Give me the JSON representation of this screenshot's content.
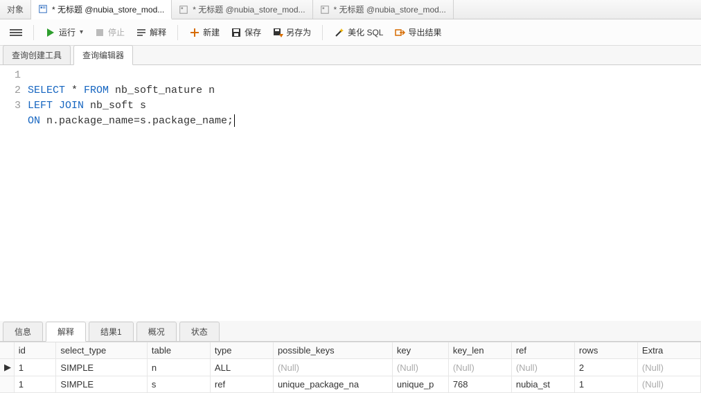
{
  "top_tabs": [
    {
      "label": "对象",
      "active": false,
      "icon": "object"
    },
    {
      "label": "* 无标题 @nubia_store_mod...",
      "active": true,
      "icon": "query"
    },
    {
      "label": "* 无标题 @nubia_store_mod...",
      "active": false,
      "icon": "query"
    },
    {
      "label": "* 无标题 @nubia_store_mod...",
      "active": false,
      "icon": "query"
    }
  ],
  "toolbar": {
    "run": "运行",
    "stop": "停止",
    "explain": "解释",
    "new": "新建",
    "save": "保存",
    "saveas": "另存为",
    "beautify": "美化 SQL",
    "export": "导出结果"
  },
  "sub_tabs": {
    "builder": "查询创建工具",
    "editor": "查询编辑器"
  },
  "sql": {
    "lines": [
      "1",
      "2",
      "3"
    ],
    "l1_select": "SELECT",
    "l1_star": " * ",
    "l1_from": "FROM",
    "l1_tail": " nb_soft_nature n",
    "l2_left": "LEFT",
    "l2_sp": " ",
    "l2_join": "JOIN",
    "l2_tail": " nb_soft s",
    "l3_on": "ON",
    "l3_tail": " n.package_name=s.package_name;"
  },
  "result_tabs": [
    "信息",
    "解释",
    "结果1",
    "概况",
    "状态"
  ],
  "result_active": 1,
  "explain_columns": [
    "id",
    "select_type",
    "table",
    "type",
    "possible_keys",
    "key",
    "key_len",
    "ref",
    "rows",
    "Extra"
  ],
  "explain_rows": [
    {
      "id": "1",
      "select_type": "SIMPLE",
      "table": "n",
      "type": "ALL",
      "possible_keys": "(Null)",
      "key": "(Null)",
      "key_len": "(Null)",
      "ref": "(Null)",
      "rows": "2",
      "Extra": "(Null)",
      "current": true
    },
    {
      "id": "1",
      "select_type": "SIMPLE",
      "table": "s",
      "type": "ref",
      "possible_keys": "unique_package_na",
      "key": "unique_p",
      "key_len": "768",
      "ref": "nubia_st",
      "rows": "1",
      "Extra": "(Null)",
      "current": false
    }
  ],
  "colors": {
    "keyword": "#1565c0",
    "null": "#aaaaaa"
  }
}
